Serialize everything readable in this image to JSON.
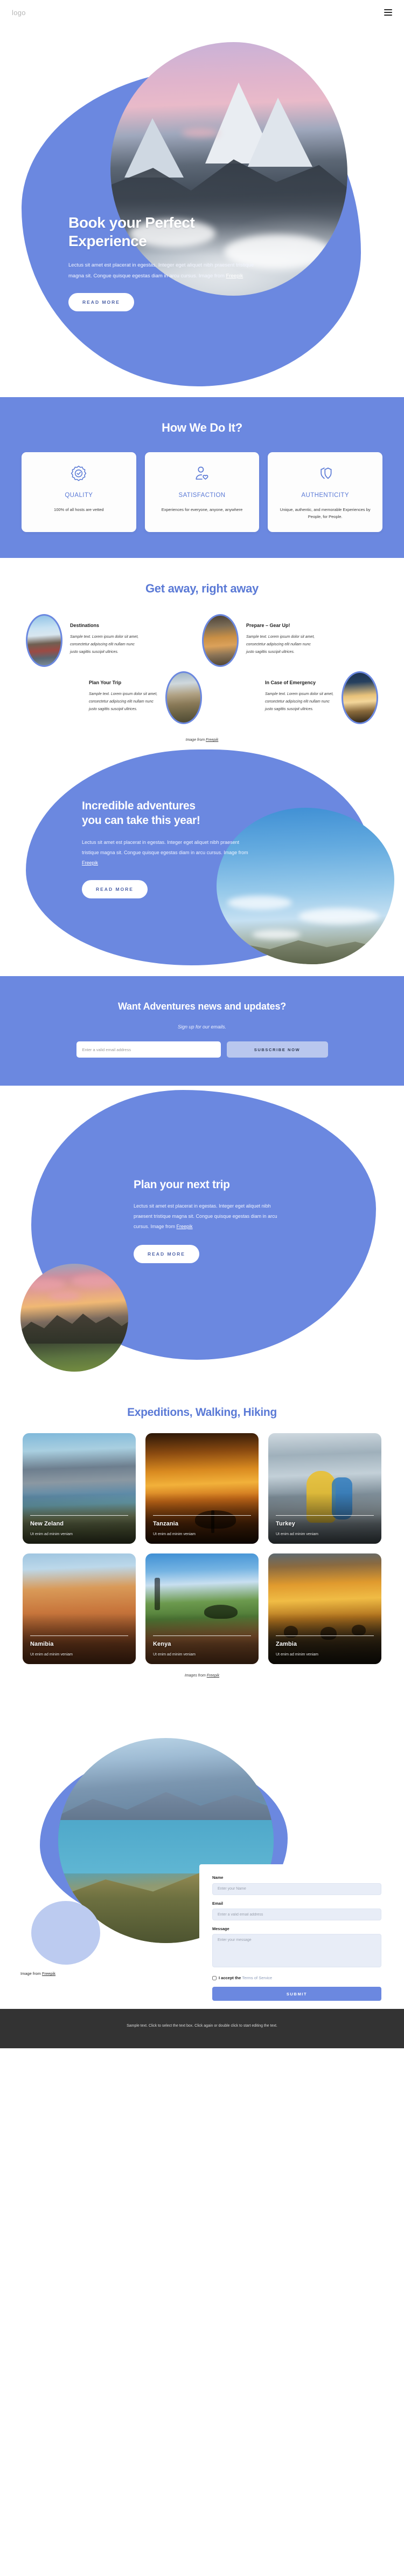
{
  "header": {
    "logo": "logo",
    "menu_icon": "hamburger-menu-icon"
  },
  "hero": {
    "title_line1": "Book your Perfect",
    "title_line2": "Experience",
    "paragraph": "Lectus sit amet est placerat in egestas. Integer eget aliquet nibh praesent tristique magna sit. Congue quisque egestas diam in arcu cursus. Image from ",
    "link": "Freepik",
    "cta": "READ MORE"
  },
  "how": {
    "title": "How We Do It?",
    "cards": [
      {
        "icon": "badge-check-icon",
        "title": "QUALITY",
        "text": "100% of all hosts are vetted"
      },
      {
        "icon": "person-heart-icon",
        "title": "SATISFACTION",
        "text": "Experiences for everyone, anyone, anywhere"
      },
      {
        "icon": "shields-icon",
        "title": "AUTHENTICITY",
        "text": "Unique, authentic, and memorable Experiences by People, for People."
      }
    ]
  },
  "getaway": {
    "title": "Get away, right away",
    "items": [
      {
        "title": "Destinations",
        "text": "Sample text. Lorem ipsum dolor sit amet, consectetur adipiscing elit nullam nunc justo sagittis suscipit ultrices."
      },
      {
        "title": "Prepare – Gear Up!",
        "text": "Sample text. Lorem ipsum dolor sit amet, consectetur adipiscing elit nullam nunc justo sagittis suscipit ultrices."
      },
      {
        "title": "Plan Your Trip",
        "text": "Sample text. Lorem ipsum dolor sit amet, consectetur adipiscing elit nullam nunc justo sagittis suscipit ultrices."
      },
      {
        "title": "In Case of Emergency",
        "text": "Sample text. Lorem ipsum dolor sit amet, consectetur adipiscing elit nullam nunc justo sagittis suscipit ultrices."
      }
    ],
    "credit_prefix": "Image from ",
    "credit_link": "Freepik"
  },
  "incredible": {
    "title_line1": "Incredible adventures",
    "title_line2": "you can take this year!",
    "paragraph": "Lectus sit amet est placerat in egestas. Integer eget aliquet nibh praesent tristique magna sit. Congue quisque egestas diam in arcu cursus. Image from ",
    "link": "Freepik",
    "cta": "READ MORE"
  },
  "newsletter": {
    "title": "Want Adventures news and updates?",
    "subtitle": "Sign up for our emails.",
    "placeholder": "Enter a valid email address",
    "button": "SUBSCRIBE NOW"
  },
  "plan": {
    "title": "Plan your next trip",
    "paragraph": "Lectus sit amet est placerat in egestas. Integer eget aliquet nibh praesent tristique magna sit. Congue quisque egestas diam in arcu cursus. Image from ",
    "link": "Freepik",
    "cta": "READ MORE"
  },
  "expeditions": {
    "title": "Expeditions, Walking, Hiking",
    "cards": [
      {
        "name": "New Zeland",
        "sub": "Ut enim ad minim veniam"
      },
      {
        "name": "Tanzania",
        "sub": "Ut enim ad minim veniam"
      },
      {
        "name": "Turkey",
        "sub": "Ut enim ad minim veniam"
      },
      {
        "name": "Namibia",
        "sub": "Ut enim ad minim veniam"
      },
      {
        "name": "Kenya",
        "sub": "Ut enim ad minim veniam"
      },
      {
        "name": "Zambia",
        "sub": "Ut enim ad minim veniam"
      }
    ],
    "credit_prefix": "Images from ",
    "credit_link": "Freepik"
  },
  "contact": {
    "name_label": "Name",
    "name_placeholder": "Enter your Name",
    "email_label": "Email",
    "email_placeholder": "Enter a valid email address",
    "message_label": "Message",
    "message_placeholder": "Enter your message",
    "accept_text": "I accept the ",
    "terms_link": "Terms of Service",
    "submit": "SUBMIT",
    "credit_prefix": "Image from ",
    "credit_link": "Freepik"
  },
  "footer": {
    "text": "Sample text. Click to select the text box. Click again or double click to start editing the text."
  },
  "colors": {
    "brand": "#6b88e0",
    "brand_text": "#5b7ad6",
    "footer_bg": "#333333",
    "field_bg": "#e8edf7"
  }
}
